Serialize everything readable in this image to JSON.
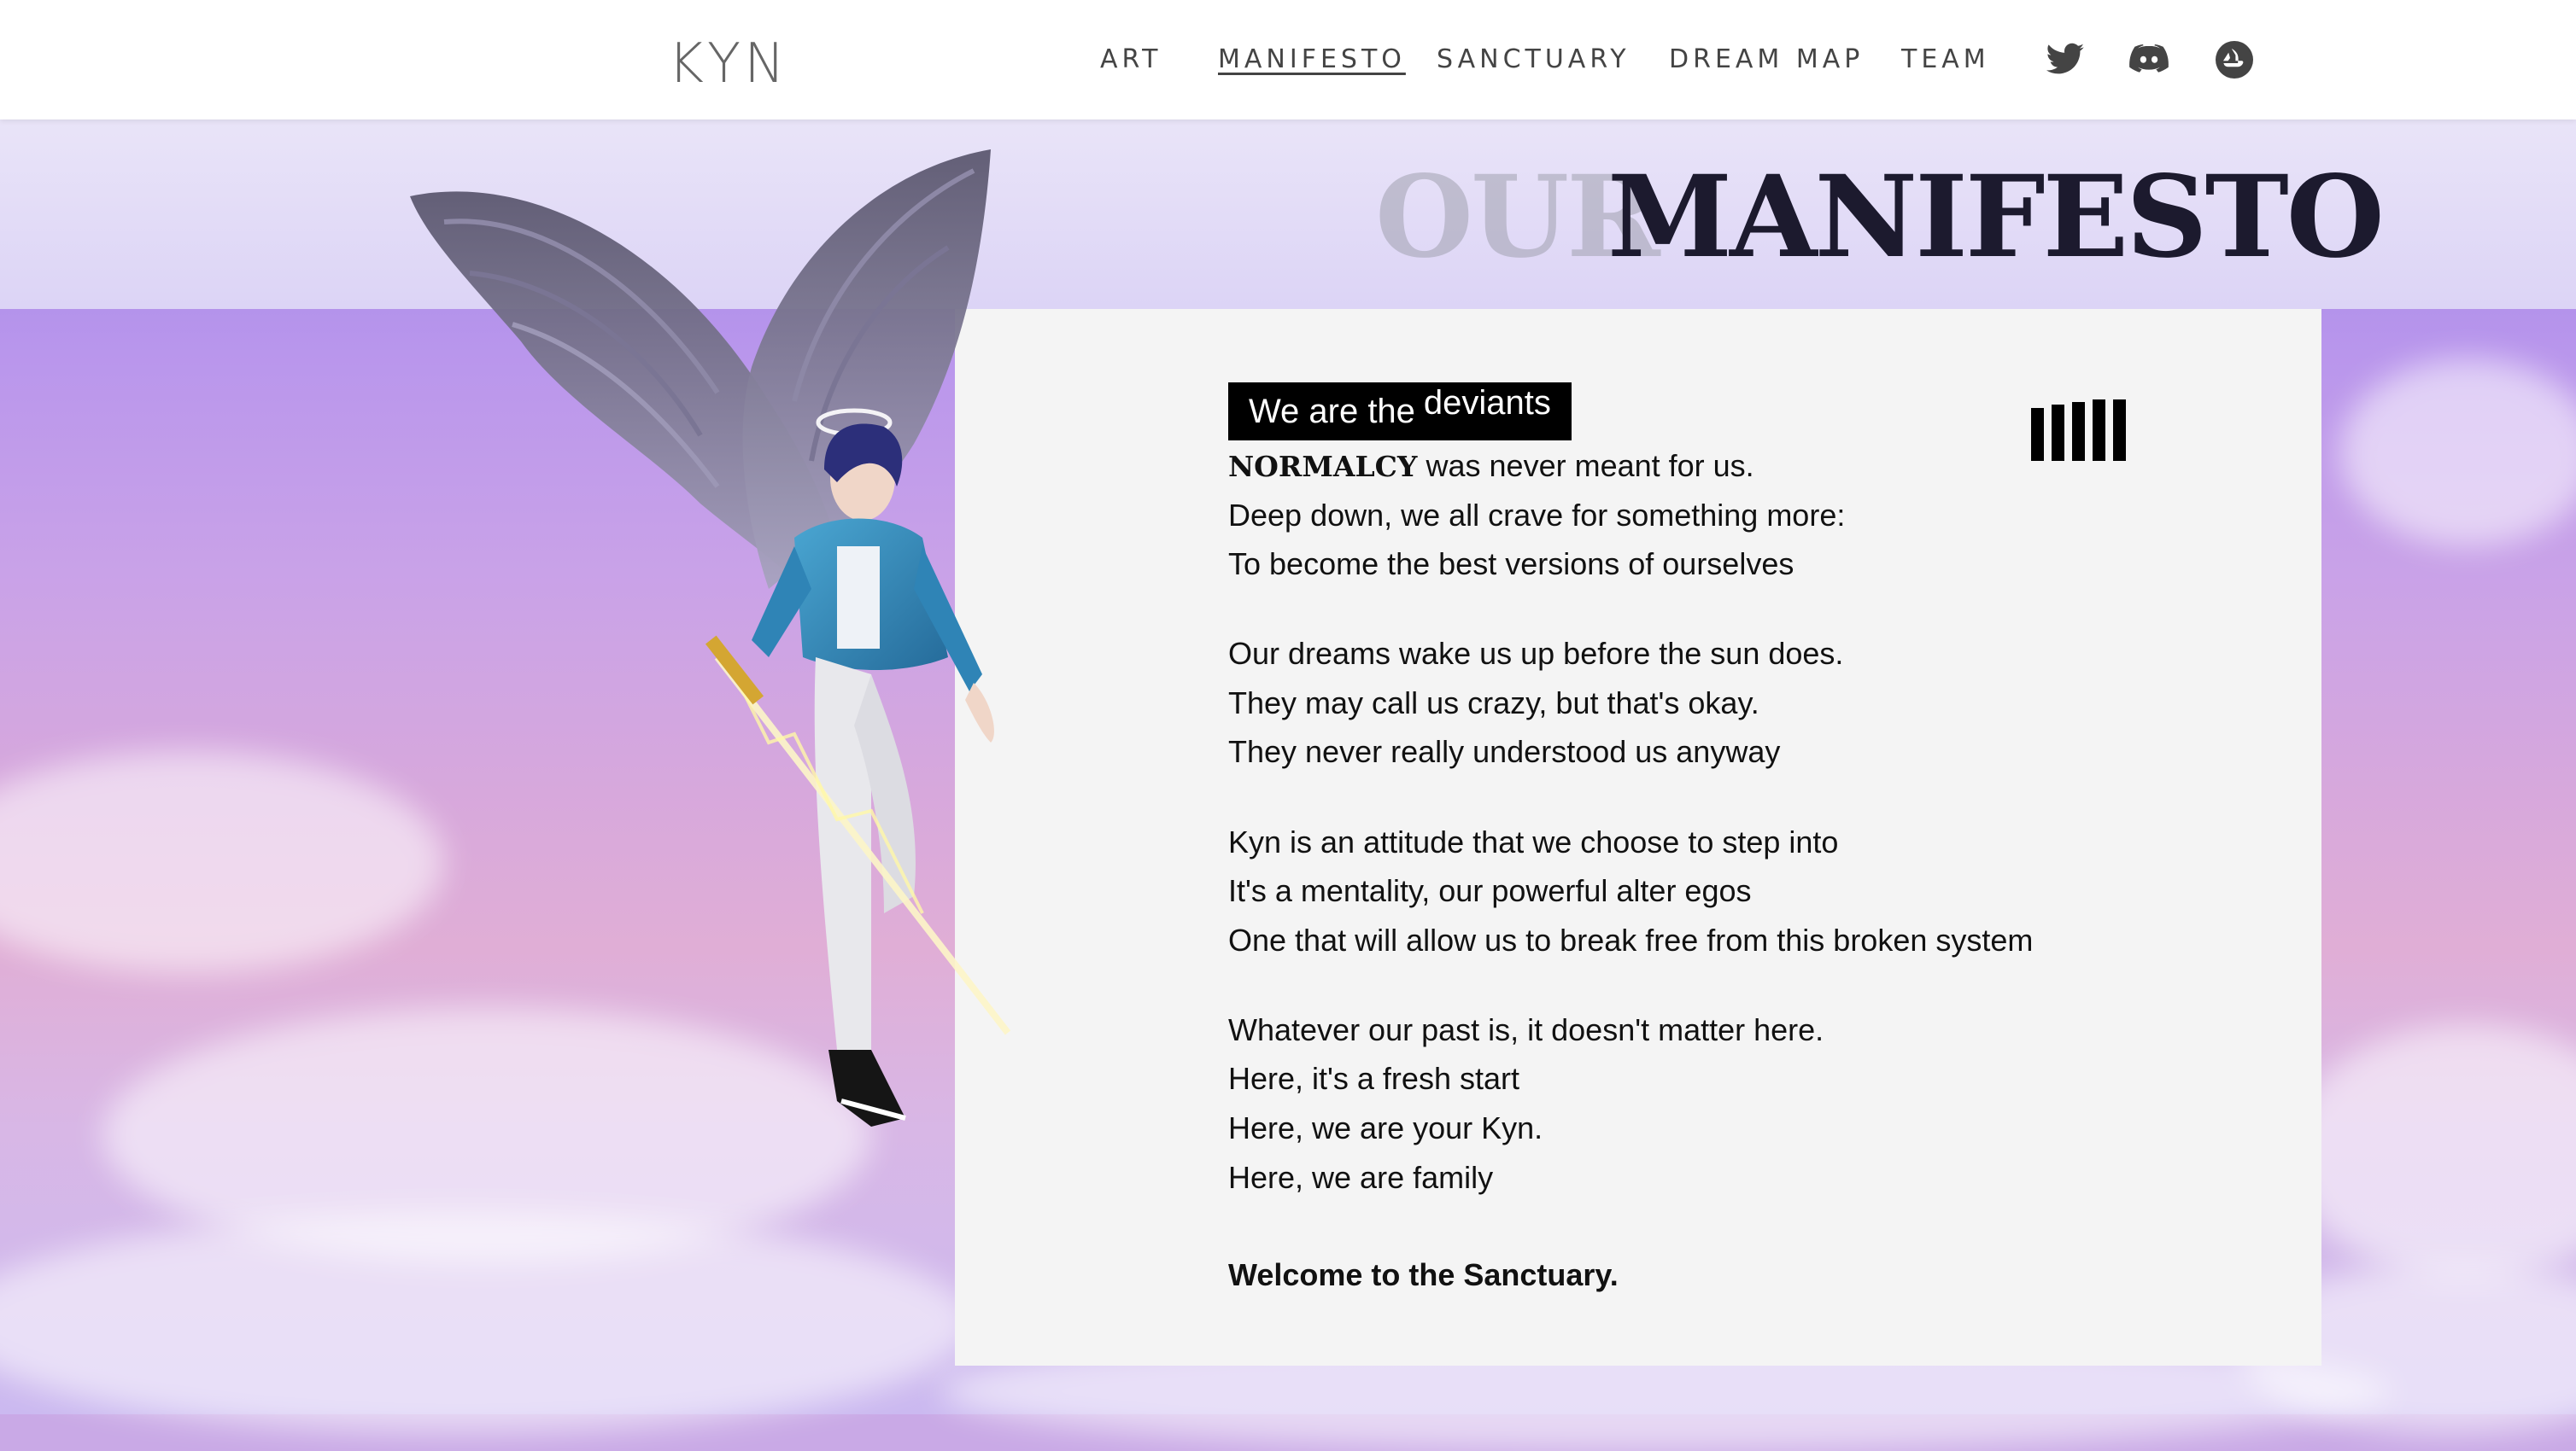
{
  "header": {
    "logo": "KYN",
    "nav": [
      {
        "label": "ART",
        "active": false
      },
      {
        "label": "MANIFESTO",
        "active": true
      },
      {
        "label": "SANCTUARY",
        "active": false
      },
      {
        "label": "DREAM MAP",
        "active": false
      },
      {
        "label": "TEAM",
        "active": false
      }
    ],
    "social_icons": [
      "twitter-icon",
      "discord-icon",
      "opensea-icon"
    ]
  },
  "title": {
    "part1": "OUR",
    "part2": "MANIFESTO"
  },
  "manifesto": {
    "tag_prefix": "We are the",
    "tag_word": "deviants",
    "first_bold": "NORMALCY",
    "first_rest": " was never meant for us.",
    "stanza1": [
      "Deep down, we all crave for something more:",
      "To become the best versions of ourselves"
    ],
    "stanza2": [
      "Our dreams wake us up before the sun does.",
      "They may call us crazy, but that's okay.",
      "They never really understood us anyway"
    ],
    "stanza3": [
      "Kyn is an attitude that we choose to step into",
      "It's a mentality, our powerful alter egos",
      "One that will allow us to break free from this broken system"
    ],
    "stanza4": [
      "Whatever our past is, it doesn't matter here.",
      "Here, it's a fresh start",
      "Here, we are your Kyn.",
      "Here, we are family"
    ],
    "closing": "Welcome to the Sanctuary."
  },
  "colors": {
    "title_dark": "#1c1a2e",
    "title_light": "#a0a0af",
    "panel_bg": "#f4f4f4",
    "jacket": "#3a8fc0"
  }
}
